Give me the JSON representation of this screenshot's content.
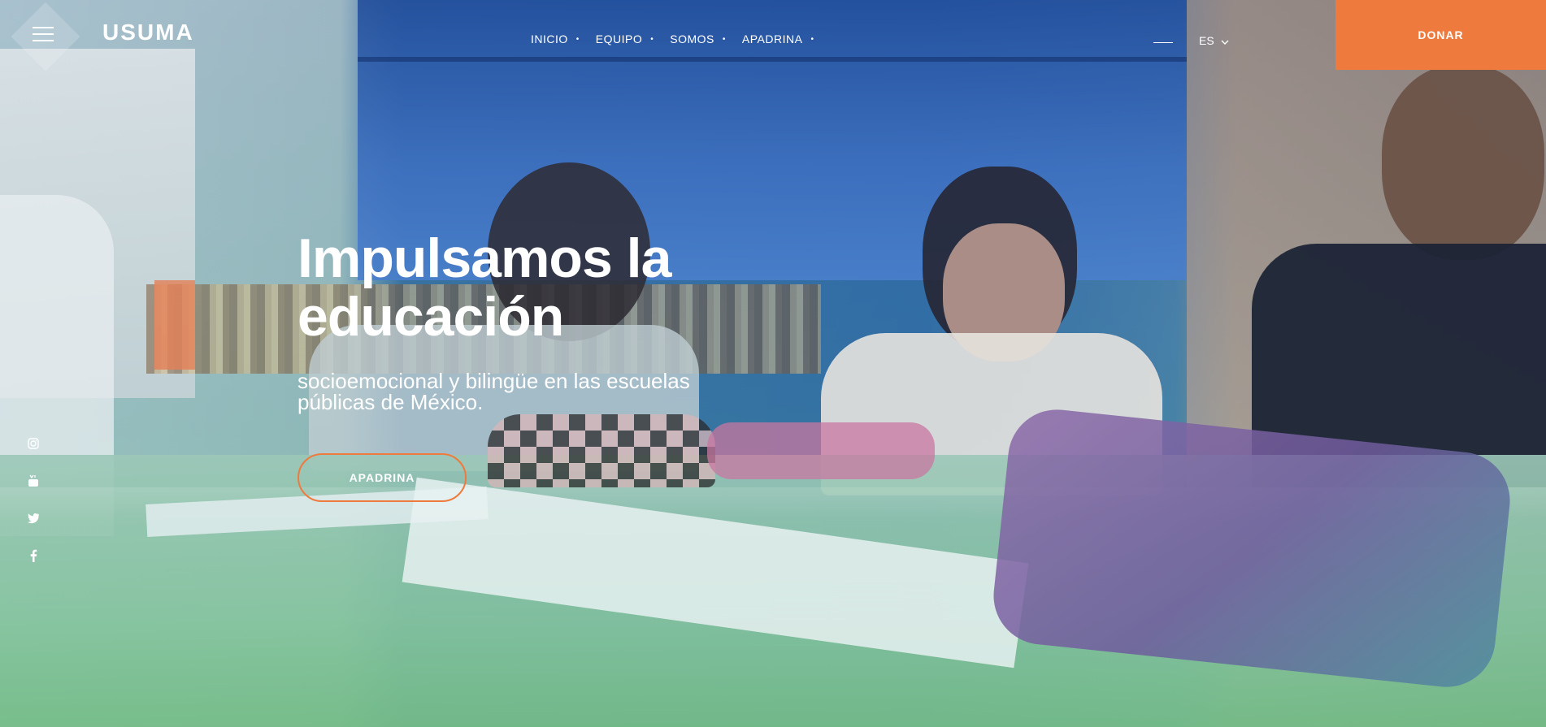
{
  "header": {
    "logo": "USUMA",
    "menu_icon": "hamburger-menu-icon",
    "nav": [
      "INICIO",
      "EQUIPO",
      "SOMOS",
      "APADRINA"
    ],
    "language": "ES",
    "language_icon": "chevron-down-icon",
    "donate_label": "DONAR"
  },
  "hero": {
    "headline_line1": "Impulsamos la",
    "headline_line2": "educación",
    "subline_line1": "socioemocional y bilingüe en las escuelas",
    "subline_line2": "públicas de México.",
    "cta_label": "APADRINA"
  },
  "social": [
    "instagram-icon",
    "youtube-icon",
    "twitter-icon",
    "facebook-icon"
  ],
  "colors": {
    "accent": "#ef7a3d",
    "text": "#ffffff"
  }
}
